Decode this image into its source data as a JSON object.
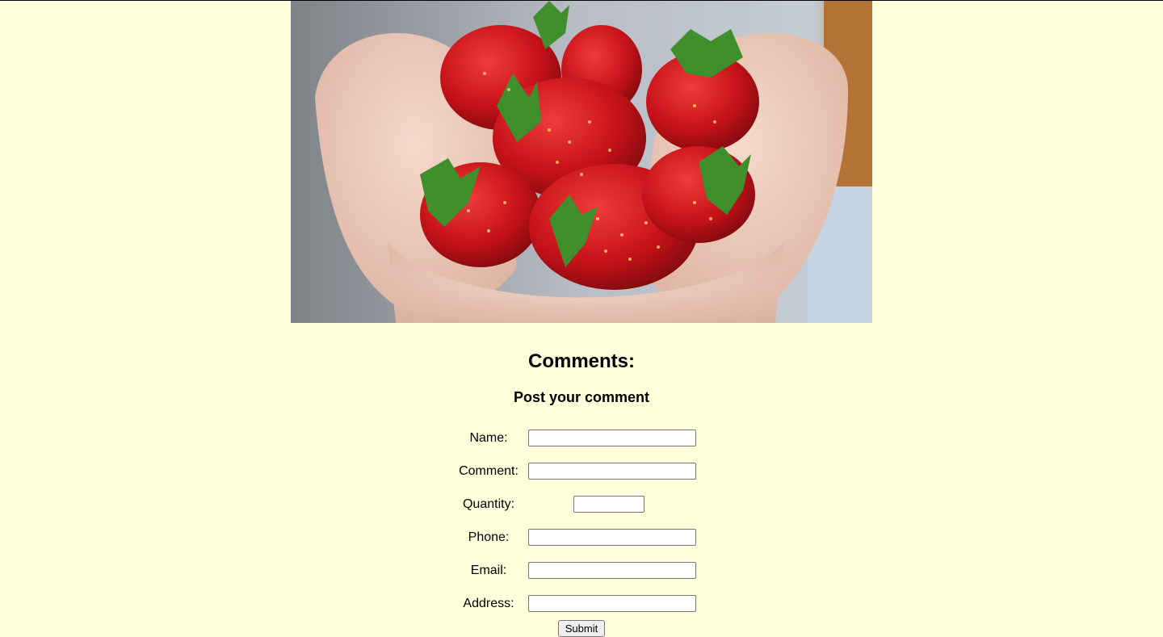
{
  "hero": {
    "icon": "strawberries-in-hands-photo"
  },
  "comments": {
    "title": "Comments:",
    "subtitle": "Post your comment"
  },
  "form": {
    "name_label": "Name:",
    "comment_label": "Comment:",
    "quantity_label": "Quantity:",
    "phone_label": "Phone:",
    "email_label": "Email:",
    "address_label": "Address:",
    "name_value": "",
    "comment_value": "",
    "quantity_value": "",
    "phone_value": "",
    "email_value": "",
    "address_value": "",
    "submit_label": "Submit"
  },
  "colors": {
    "background": "#ffffdb"
  }
}
